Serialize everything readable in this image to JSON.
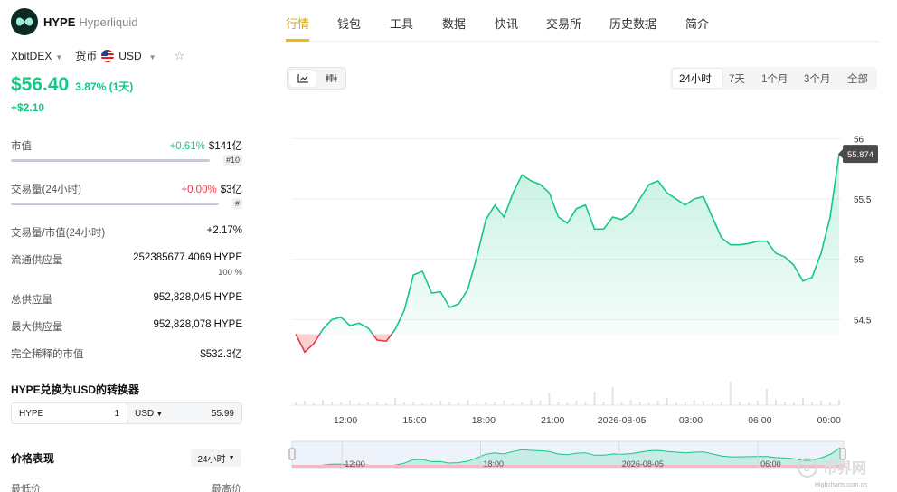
{
  "header": {
    "symbol": "HYPE",
    "name": "Hyperliquid",
    "exchange": "XbitDEX",
    "currency_label": "货币",
    "currency": "USD"
  },
  "price": {
    "value": "$56.40",
    "change_pct": "3.87% (1天)",
    "change_abs": "+$2.10"
  },
  "stats": {
    "market_cap": {
      "label": "市值",
      "change": "+0.61%",
      "value": "$141亿",
      "rank": "#10"
    },
    "volume": {
      "label": "交易量(24小时)",
      "change": "+0.00%",
      "value": "$3亿",
      "rank": "#"
    },
    "vol_mcap": {
      "label": "交易量/市值(24小时)",
      "value": "+2.17%"
    },
    "circulating": {
      "label": "流通供应量",
      "value": "252385677.4069 HYPE",
      "pct": "100 %"
    },
    "total_supply": {
      "label": "总供应量",
      "value": "952,828,045 HYPE"
    },
    "max_supply": {
      "label": "最大供应量",
      "value": "952,828,078 HYPE"
    },
    "fdv": {
      "label": "完全稀释的市值",
      "value": "$532.3亿"
    }
  },
  "converter": {
    "title": "HYPE兑换为USD的转换器",
    "from_symbol": "HYPE",
    "from_amount": "1",
    "to_symbol": "USD",
    "to_amount": "55.99"
  },
  "performance": {
    "title": "价格表现",
    "period": "24小时",
    "low_label": "最低价",
    "high_label": "最高价"
  },
  "nav": {
    "tabs": [
      "行情",
      "钱包",
      "工具",
      "数据",
      "快讯",
      "交易所",
      "历史数据",
      "简介"
    ],
    "active": 0
  },
  "time_ranges": [
    "24小时",
    "7天",
    "1个月",
    "3个月",
    "全部"
  ],
  "active_range": 0,
  "colors": {
    "up": "#16c784",
    "down": "#ea3943",
    "accent": "#f0b90b",
    "tag": "#4a4a4a"
  },
  "icons": [
    "line-chart-icon",
    "candlestick-chart-icon",
    "star-icon",
    "chevron-down-icon"
  ],
  "watermark": "Highcharts.com.cn",
  "chart_data": {
    "type": "area",
    "x_ticks": [
      "12:00",
      "15:00",
      "18:00",
      "21:00",
      "2026-08-05",
      "03:00",
      "06:00",
      "09:00"
    ],
    "navigator_ticks": [
      "12:00",
      "18:00",
      "2026-08-05",
      "06:00"
    ],
    "y_ticks": [
      56,
      55.5,
      55,
      54.5
    ],
    "ylim": [
      54.3,
      56.1
    ],
    "baseline": 54.38,
    "last_price": "55.874",
    "x_hours": [
      0,
      0.4,
      0.8,
      1.2,
      1.6,
      2.0,
      2.4,
      2.8,
      3.2,
      3.6,
      4.0,
      4.4,
      4.8,
      5.2,
      5.6,
      6.0,
      6.4,
      6.8,
      7.2,
      7.6,
      8.0,
      8.4,
      8.8,
      9.2,
      9.6,
      10.0,
      10.4,
      10.8,
      11.2,
      11.6,
      12.0,
      12.4,
      12.8,
      13.2,
      13.6,
      14.0,
      14.4,
      14.8,
      15.2,
      15.6,
      16.0,
      16.4,
      16.8,
      17.2,
      17.6,
      18.0,
      18.4,
      18.8,
      19.2,
      19.6,
      20.0,
      20.4,
      20.8,
      21.2,
      21.6,
      22.0,
      22.4,
      22.8,
      23.2,
      23.6,
      24.0
    ],
    "y_values": [
      54.38,
      54.23,
      54.3,
      54.42,
      54.5,
      54.52,
      54.45,
      54.47,
      54.43,
      54.33,
      54.32,
      54.42,
      54.58,
      54.87,
      54.9,
      54.72,
      54.73,
      54.6,
      54.63,
      54.75,
      55.02,
      55.33,
      55.45,
      55.35,
      55.55,
      55.7,
      55.65,
      55.62,
      55.55,
      55.35,
      55.3,
      55.42,
      55.45,
      55.25,
      55.25,
      55.35,
      55.33,
      55.38,
      55.5,
      55.62,
      55.65,
      55.55,
      55.5,
      55.45,
      55.5,
      55.52,
      55.35,
      55.18,
      55.12,
      55.12,
      55.13,
      55.15,
      55.15,
      55.05,
      55.02,
      54.95,
      54.82,
      54.85,
      55.05,
      55.35,
      55.874
    ],
    "volume": [
      3,
      5,
      2,
      6,
      4,
      3,
      5,
      2,
      3,
      4,
      2,
      8,
      3,
      4,
      2,
      3,
      5,
      4,
      3,
      6,
      4,
      3,
      4,
      5,
      2,
      3,
      6,
      5,
      14,
      4,
      3,
      5,
      3,
      15,
      4,
      20,
      3,
      6,
      4,
      3,
      5,
      8,
      3,
      4,
      6,
      5,
      3,
      4,
      26,
      4,
      3,
      5,
      18,
      6,
      4,
      3,
      8,
      4,
      5,
      3,
      6
    ]
  }
}
